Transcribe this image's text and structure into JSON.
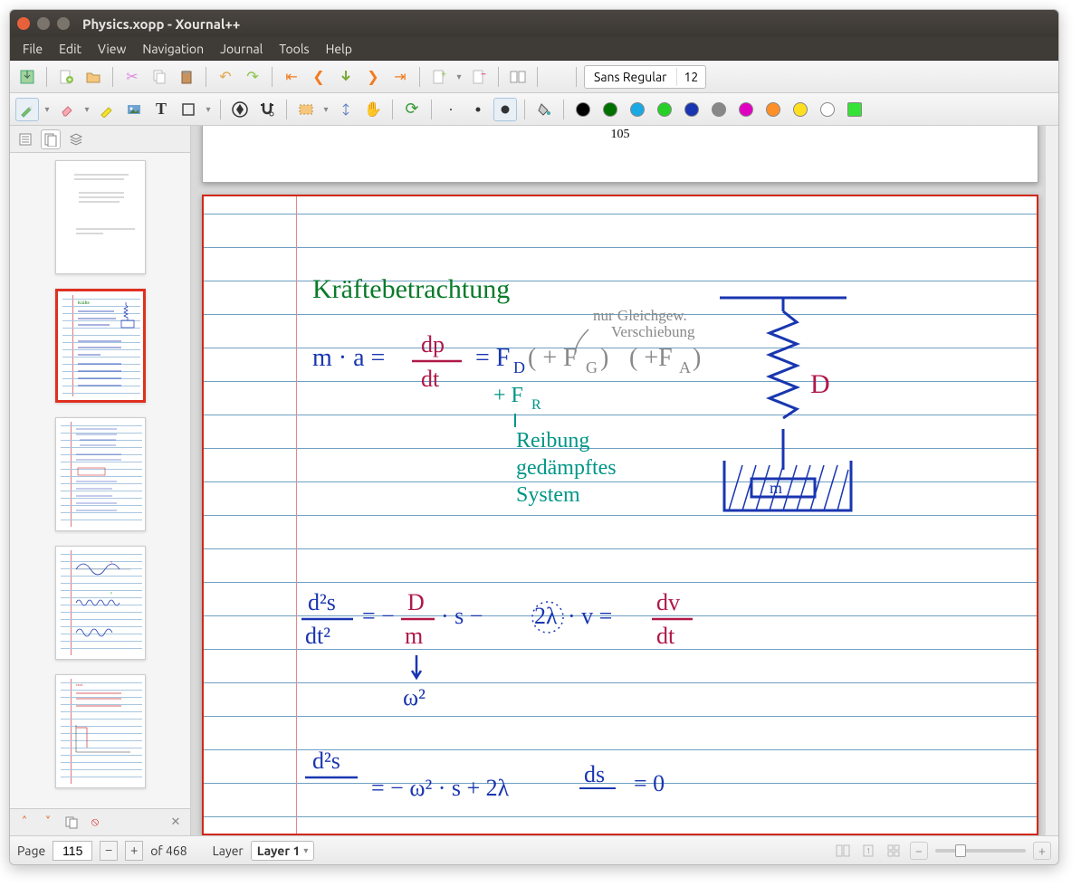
{
  "window": {
    "title": "Physics.xopp - Xournal++"
  },
  "menubar": [
    "File",
    "Edit",
    "View",
    "Navigation",
    "Journal",
    "Tools",
    "Help"
  ],
  "toolbar1": {
    "color_circle": "#e21a1a",
    "font_name": "Sans Regular",
    "font_size": "12"
  },
  "toolbar2": {
    "colors": [
      "#000000",
      "#007000",
      "#1aa9e2",
      "#27cf27",
      "#1936b0",
      "#6d00b0",
      "#e000c0",
      "#ff9028",
      "#ffe020",
      "#ffffff",
      "#37e237"
    ]
  },
  "sidebar": {
    "thumbs_count": 5,
    "selected_index": 1
  },
  "canvas": {
    "prev_page_number": "105",
    "notes": {
      "title": "Kräftebetrachtung",
      "annotation": "nur Gleichgew.\nVerschiebung",
      "eq1_lhs": "m · a =",
      "eq1_frac_num": "dp",
      "eq1_frac_den": "dt",
      "eq1_rhs": "= F_D ( + F_G )  ( +F_A )",
      "eq1_below": "+ F_R",
      "reibung1": "Reibung",
      "reibung2": "gedämpftes",
      "reibung3": "System",
      "spring_label": "D",
      "eq2": "d²s/dt²  =  − D/m · s  −  2λ · v  =  dv/dt",
      "eq2_arrow": "↓",
      "eq2_below": "ω²",
      "eq3": "d²s      =  − ω² · s  + 2λ  ds   = 0"
    }
  },
  "statusbar": {
    "page_label": "Page",
    "page_current": "115",
    "page_total": "of 468",
    "layer_label": "Layer",
    "layer_value": "Layer 1"
  }
}
